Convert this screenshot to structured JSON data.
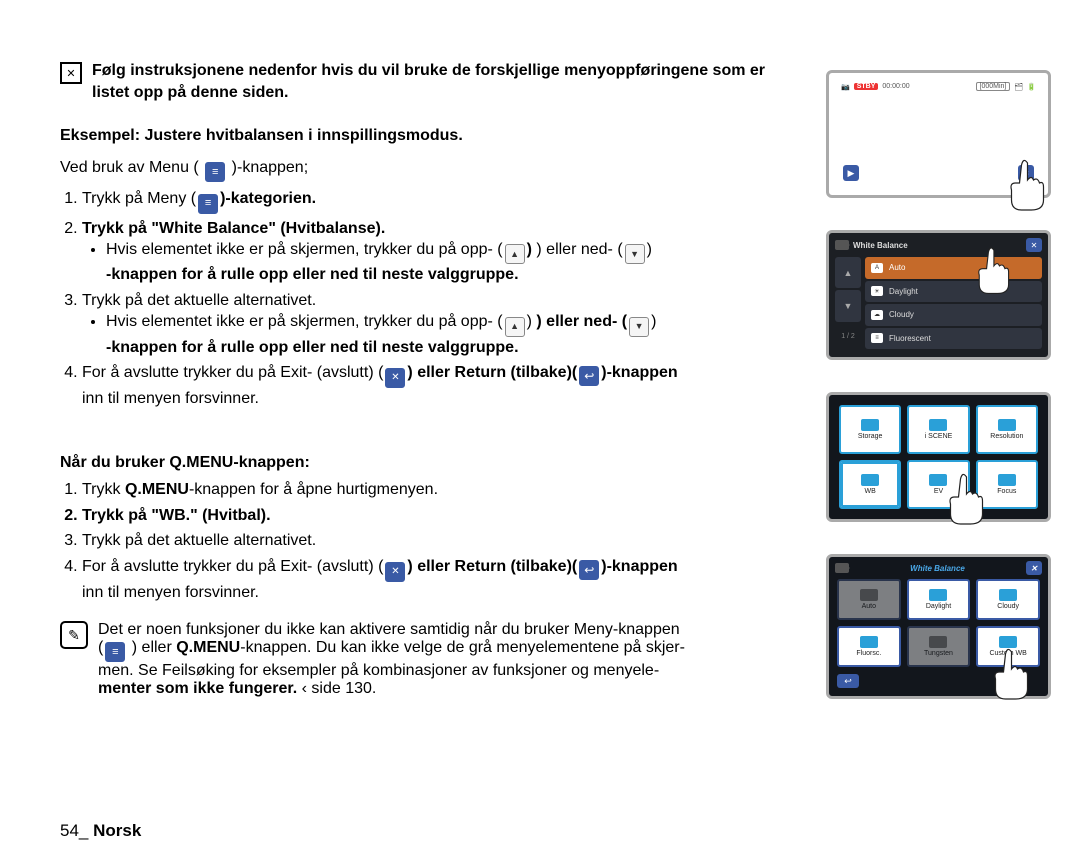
{
  "intro": "Følg instruksjonene nedenfor hvis du vil bruke de forskjellige menyoppføringene som er listet opp på denne siden.",
  "example_heading": "Eksempel: Justere hvitbalansen i innspillingsmodus.",
  "menu_usage_prefix": "Ved bruk av Menu (",
  "menu_usage_suffix": ")-knappen;",
  "steps_menu": {
    "s1_pre": "Trykk på Meny (",
    "s1_post_bold": ")-kategorien.",
    "s2": "Trykk på \"White Balance\" (Hvitbalanse).",
    "s2_bullet_pre": "Hvis elementet ikke er på skjermen, trykker du på opp- (",
    "s2_bullet_mid": ") eller ned- (",
    "s2_bullet_post": ")",
    "s2_bullet_line2": "-knappen for å rulle opp eller ned til neste valggruppe.",
    "s3": "Trykk på det aktuelle alternativet.",
    "s3_bullet_pre": "Hvis elementet ikke er på skjermen, trykker du på opp- (",
    "s3_bullet_mid": ") eller ned- (",
    "s3_bullet_post": ")",
    "s3_bullet_line2": "-knappen for å rulle opp eller ned til neste valggruppe.",
    "s4_pre": "For å avslutte trykker du på Exit- (avslutt) (",
    "s4_mid1": ") eller Return (tilbake)(",
    "s4_mid2": ")-knappen",
    "s4_post": "inn til menyen forsvinner."
  },
  "qmenu_heading": "Når du bruker Q.MENU-knappen:",
  "steps_q": {
    "s1_pre": "Trykk ",
    "s1_bold": "Q.MENU",
    "s1_post": "-knappen for å åpne hurtigmenyen.",
    "s2": "Trykk på \"WB.\" (Hvitbal).",
    "s3": "Trykk på det aktuelle alternativet.",
    "s4_pre": "For å avslutte trykker du på Exit- (avslutt) (",
    "s4_mid1": ") eller Return (tilbake)(",
    "s4_mid2": ")-knappen",
    "s4_post": "inn til menyen forsvinner."
  },
  "note": {
    "l1_pre": "Det er noen funksjoner du ikke kan aktivere samtidig når du bruker Meny-knappen",
    "l2_pre": "(",
    "l2_mid": " ) eller ",
    "l2_bold": "Q.MENU",
    "l2_post": "-knappen. Du kan ikke velge de grå menyelementene på skjer-",
    "l3": "men. Se Feilsøking for eksempler på kombinasjoner av funksjoner og menyele-",
    "l4_bold": "menter som ikke fungerer.",
    "l4_ref": " ‹ side 130."
  },
  "footer_page": "54_ ",
  "footer_lang": "Norsk",
  "figs": {
    "f1": {
      "stby": "STBY",
      "time": "00:00:00",
      "remain": "[000Min]"
    },
    "f2": {
      "title": "White Balance",
      "page": "1 / 2",
      "items": [
        "Auto",
        "Daylight",
        "Cloudy",
        "Fluorescent"
      ]
    },
    "f3": {
      "tiles": [
        "Storage",
        "i SCENE",
        "Resolution",
        "WB",
        "EV",
        "Focus"
      ]
    },
    "f4": {
      "title": "White Balance",
      "tiles": [
        "Auto",
        "Daylight",
        "Cloudy",
        "Fluorsc.",
        "Tungsten",
        "Custom WB"
      ]
    }
  }
}
